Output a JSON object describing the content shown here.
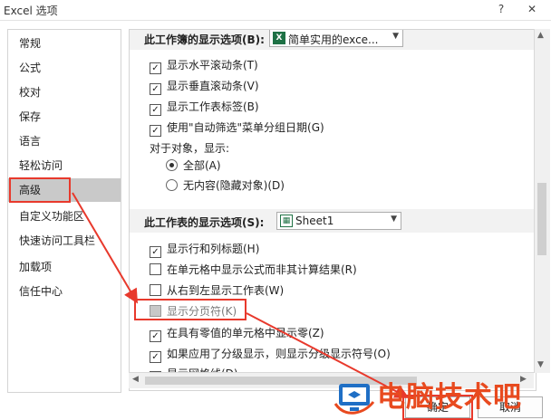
{
  "window": {
    "title": "Excel 选项",
    "help": "?",
    "close": "✕"
  },
  "nav": {
    "items": [
      {
        "label": "常规"
      },
      {
        "label": "公式"
      },
      {
        "label": "校对"
      },
      {
        "label": "保存"
      },
      {
        "label": "语言"
      },
      {
        "label": "轻松访问"
      },
      {
        "label": "高级",
        "selected": true
      },
      {
        "label": "自定义功能区"
      },
      {
        "label": "快速访问工具栏"
      },
      {
        "label": "加载项"
      },
      {
        "label": "信任中心"
      }
    ]
  },
  "workbook_section": {
    "title": "此工作簿的显示选项(B):",
    "dropdown": "简单实用的exce...",
    "dropdown_icon": "X",
    "options": [
      {
        "label": "显示水平滚动条(T)",
        "checked": true
      },
      {
        "label": "显示垂直滚动条(V)",
        "checked": true
      },
      {
        "label": "显示工作表标签(B)",
        "checked": true
      },
      {
        "label": "使用\"自动筛选\"菜单分组日期(G)",
        "checked": true
      }
    ],
    "objects_label": "对于对象，显示:",
    "radios": [
      {
        "label": "全部(A)",
        "selected": true
      },
      {
        "label": "无内容(隐藏对象)(D)",
        "selected": false
      }
    ]
  },
  "sheet_section": {
    "title": "此工作表的显示选项(S):",
    "dropdown": "Sheet1",
    "options": [
      {
        "label": "显示行和列标题(H)",
        "checked": true
      },
      {
        "label": "在单元格中显示公式而非其计算结果(R)",
        "checked": false
      },
      {
        "label": "从右到左显示工作表(W)",
        "checked": false
      },
      {
        "label": "显示分页符(K)",
        "checked": false,
        "disabled": true
      },
      {
        "label": "在具有零值的单元格中显示零(Z)",
        "checked": true
      },
      {
        "label": "如果应用了分级显示，则显示分级显示符号(O)",
        "checked": true
      },
      {
        "label": "显示网格线(D)",
        "checked": true
      }
    ]
  },
  "buttons": {
    "ok": "确定",
    "cancel": "取消"
  },
  "watermark": {
    "text": "电脑技术吧"
  },
  "colors": {
    "highlight": "#e8392c",
    "selected_nav": "#c9c9c9",
    "excel_green": "#217346"
  }
}
